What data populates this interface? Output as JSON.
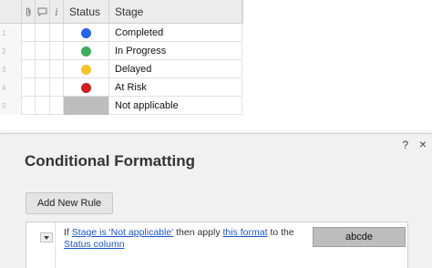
{
  "grid": {
    "columns": {
      "status_label": "Status",
      "stage_label": "Stage",
      "icons": [
        "attachment-icon",
        "comment-icon",
        "info-icon"
      ],
      "info_glyph": "i"
    },
    "rows": [
      {
        "num": "1",
        "status_color": "#2563eb",
        "stage": "Completed"
      },
      {
        "num": "2",
        "status_color": "#3cae5e",
        "stage": "In Progress"
      },
      {
        "num": "3",
        "status_color": "#f4c32a",
        "stage": "Delayed"
      },
      {
        "num": "4",
        "status_color": "#cf1f1f",
        "stage": "At Risk"
      },
      {
        "num": "5",
        "status_color": "#bdbdbd",
        "stage": "Not applicable"
      }
    ]
  },
  "dialog": {
    "help_glyph": "?",
    "close_glyph": "×",
    "title": "Conditional Formatting",
    "add_rule_label": "Add New Rule",
    "rule": {
      "prefix": "If",
      "condition_link": "Stage is 'Not applicable'",
      "middle": "then apply",
      "format_link": "this format",
      "suffix": "to the",
      "target_link": "Status column",
      "preview_text": "abcde"
    }
  }
}
